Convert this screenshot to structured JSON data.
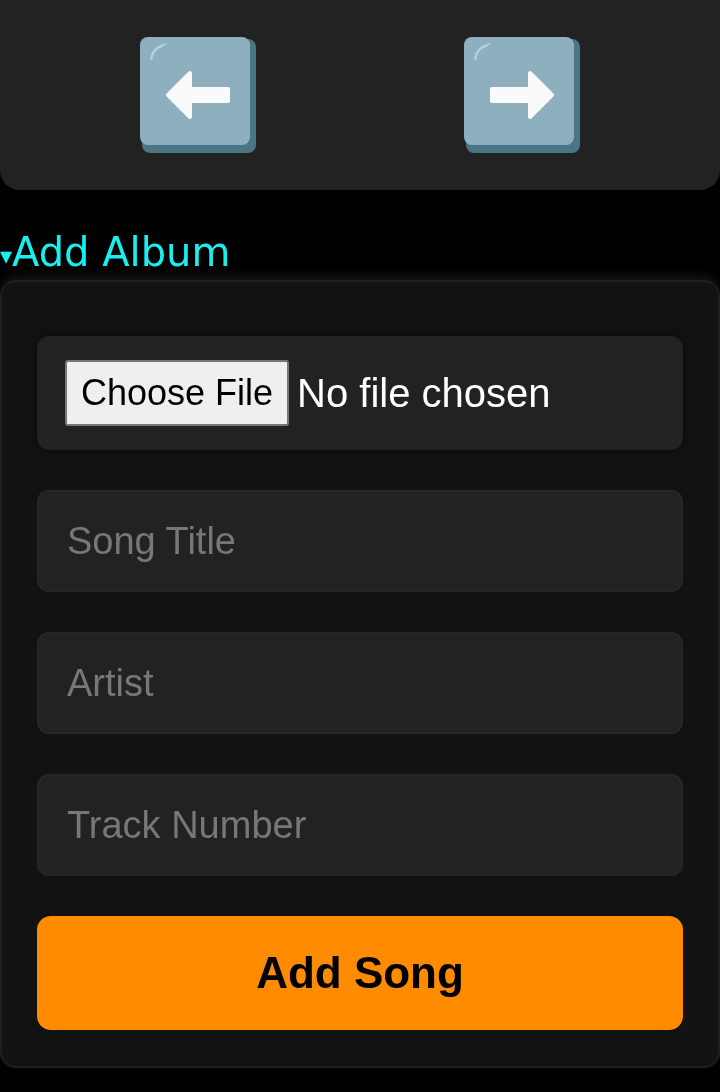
{
  "nav": {
    "buttons": [
      {
        "kind": "back"
      },
      {
        "kind": "forward"
      }
    ]
  },
  "section": {
    "marker": "▾",
    "title": "Add Album",
    "expanded": true
  },
  "file_input": {
    "button": "Choose File",
    "status": "No file chosen"
  },
  "fields": [
    {
      "placeholder": "Song Title"
    },
    {
      "placeholder": "Artist"
    },
    {
      "placeholder": "Track Number"
    }
  ],
  "submit": "Add Song"
}
